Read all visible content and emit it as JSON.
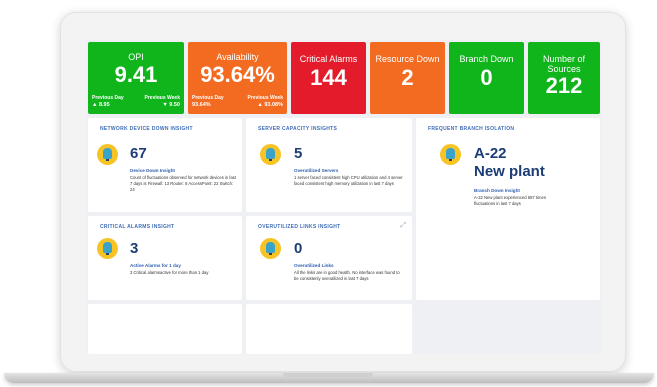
{
  "colors": {
    "green": "#10b51c",
    "orange": "#f36b21",
    "red": "#e41b2b",
    "title_blue": "#3f6db8",
    "number_navy": "#1c3d76"
  },
  "kpis": [
    {
      "label": "OPI",
      "value": "9.41",
      "color": "#10b51c",
      "prev_day_label": "Previous Day",
      "prev_day_value": "▲ 8.95",
      "prev_week_label": "Previous Week",
      "prev_week_value": "▼ 9.50"
    },
    {
      "label": "Availability",
      "value": "93.64%",
      "color": "#f36b21",
      "prev_day_label": "Previous Day",
      "prev_day_value": "93.64%",
      "prev_week_label": "Previous Week",
      "prev_week_value": "▲ 93.08%"
    },
    {
      "label": "Critical Alarms",
      "value": "144",
      "color": "#e41b2b"
    },
    {
      "label": "Resource Down",
      "value": "2",
      "color": "#f36b21"
    },
    {
      "label": "Branch Down",
      "value": "0",
      "color": "#10b51c"
    },
    {
      "label": "Number of Sources",
      "value": "212",
      "color": "#10b51c"
    }
  ],
  "cards": {
    "network_device_down": {
      "title": "NETWORK DEVICE DOWN INSIGHT",
      "number": "67",
      "subtitle": "Device Down Insight",
      "description": "Count of fluctuations observed for network devices in last 7 days is Firewall: 13 Router: 8 AccessPoint: 22 Switch: 24",
      "icon": "lightbulb-icon"
    },
    "server_capacity": {
      "title": "SERVER CAPACITY INSIGHTS",
      "number": "5",
      "subtitle": "Overutilized Servers",
      "description": "1 server faced consistent high CPU utilization and 4 server faced consistent high memory utilization in last 7 days",
      "icon": "lightbulb-icon"
    },
    "frequent_branch_isolation": {
      "title": "FREQUENT BRANCH ISOLATION",
      "number_line1": "A-22",
      "number_line2": "New plant",
      "subtitle": "Branch Down Insight",
      "description": "A-22 New plant experienced 687 times fluctuations in last 7 days",
      "icon": "lightbulb-icon"
    },
    "critical_alarms": {
      "title": "CRITICAL ALARMS INSIGHT",
      "number": "3",
      "subtitle": "Active Alarms for 1 day",
      "description": "3 Critical alarmsactive for more than 1 day",
      "icon": "lightbulb-icon"
    },
    "overutilized_links": {
      "title": "OVERUTILIZED LINKS INSIGHT",
      "number": "0",
      "subtitle": "Overutilized Links",
      "description": "All the links are in good health. No interface was found to be consistenly overutilized in last 7 days",
      "icon": "lightbulb-icon",
      "expand_icon": "expand-icon"
    }
  }
}
